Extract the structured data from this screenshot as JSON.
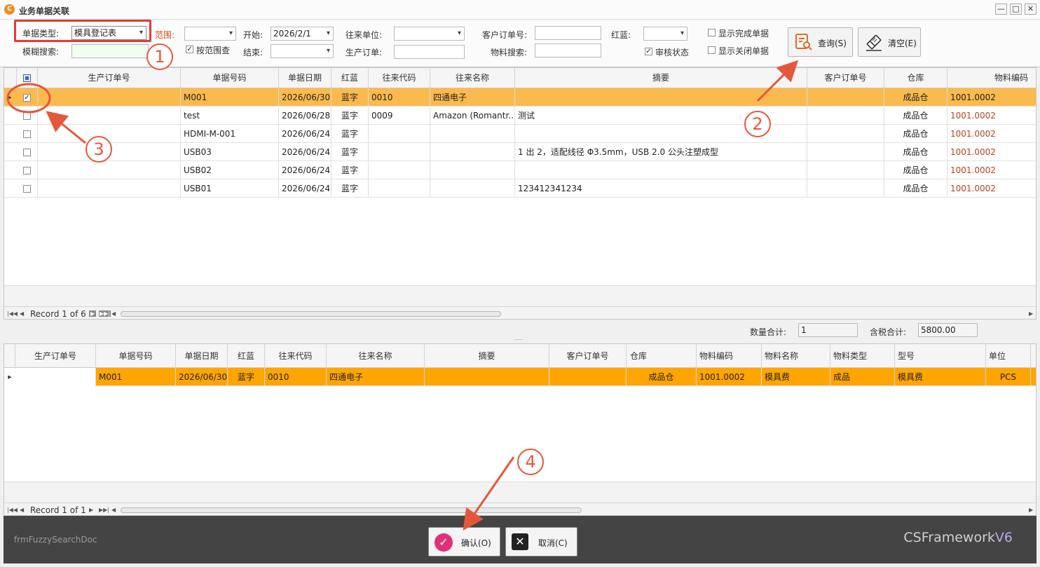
{
  "window": {
    "title": "业务单据关联",
    "min": "—",
    "max": "□",
    "close": "✕"
  },
  "filter": {
    "doc_type_label": "单据类型:",
    "doc_type_value": "模具登记表",
    "fuzzy_label": "模糊搜索:",
    "fuzzy_value": "",
    "range_label": "范围:",
    "range_value": "",
    "range_check_label": "按范围查",
    "range_checked": true,
    "start_label": "开始:",
    "start_value": "2026/2/1",
    "end_label": "结束:",
    "end_value": "",
    "partner_label": "往来单位:",
    "partner_value": "",
    "prod_order_label": "生产订单:",
    "prod_order_value": "",
    "cust_order_label": "客户订单号:",
    "cust_order_value": "",
    "material_label": "物料搜索:",
    "material_value": "",
    "redblue_label": "红蓝:",
    "redblue_value": "",
    "show_done_label": "显示完成单据",
    "show_done": false,
    "audit_label": "审核状态",
    "audit": true,
    "show_closed_label": "显示关闭单据",
    "show_closed": false,
    "query_label": "查询(S)",
    "clear_label": "清空(E)"
  },
  "top_grid": {
    "columns": [
      "",
      "生产订单号",
      "单据号码",
      "单据日期",
      "红蓝",
      "往来代码",
      "往来名称",
      "摘要",
      "客户订单号",
      "仓库",
      "物料编码"
    ],
    "rows": [
      {
        "checked": true,
        "prod_order": "",
        "doc_no": "M001",
        "date": "2026/06/30",
        "rb": "蓝字",
        "code": "0010",
        "name": "四通电子",
        "summary": "",
        "cust": "",
        "wh": "成品仓",
        "mat": "1001.0002"
      },
      {
        "checked": false,
        "prod_order": "",
        "doc_no": "test",
        "date": "2026/06/28",
        "rb": "蓝字",
        "code": "0009",
        "name": "Amazon (Romantr...",
        "summary": "测试",
        "cust": "",
        "wh": "成品仓",
        "mat": "1001.0002"
      },
      {
        "checked": false,
        "prod_order": "",
        "doc_no": "HDMI-M-001",
        "date": "2026/06/24",
        "rb": "蓝字",
        "code": "",
        "name": "",
        "summary": "",
        "cust": "",
        "wh": "成品仓",
        "mat": "1001.0002"
      },
      {
        "checked": false,
        "prod_order": "",
        "doc_no": "USB03",
        "date": "2026/06/24",
        "rb": "蓝字",
        "code": "",
        "name": "",
        "summary": "1 出 2，适配线径 Φ3.5mm，USB 2.0 公头注塑成型",
        "cust": "",
        "wh": "成品仓",
        "mat": "1001.0002"
      },
      {
        "checked": false,
        "prod_order": "",
        "doc_no": "USB02",
        "date": "2026/06/24",
        "rb": "蓝字",
        "code": "",
        "name": "",
        "summary": "",
        "cust": "",
        "wh": "成品仓",
        "mat": "1001.0002"
      },
      {
        "checked": false,
        "prod_order": "",
        "doc_no": "USB01",
        "date": "2026/06/24",
        "rb": "蓝字",
        "code": "",
        "name": "",
        "summary": "123412341234",
        "cust": "",
        "wh": "成品仓",
        "mat": "1001.0002"
      }
    ],
    "record_text": "Record 1 of 6"
  },
  "totals": {
    "qty_label": "数量合计:",
    "qty_value": "1",
    "tax_label": "含税合计:",
    "tax_value": "5800.00",
    "splitter": "....."
  },
  "bottom_grid": {
    "columns": [
      "生产订单号",
      "单据号码",
      "单据日期",
      "红蓝",
      "往来代码",
      "往来名称",
      "摘要",
      "客户订单号",
      "仓库",
      "物料编码",
      "物料名称",
      "物料类型",
      "型号",
      "单位"
    ],
    "rows": [
      {
        "prod_order": "",
        "doc_no": "M001",
        "date": "2026/06/30",
        "rb": "蓝字",
        "code": "0010",
        "name": "四通电子",
        "summary": "",
        "cust": "",
        "wh": "成品仓",
        "mat": "1001.0002",
        "mat_name": "模具费",
        "mat_type": "成品",
        "model": "模具费",
        "unit": "PCS"
      }
    ],
    "record_text": "Record 1 of 1"
  },
  "footer": {
    "form_name": "frmFuzzySearchDoc",
    "brand_main": "CSFramework",
    "brand_ver": "V6",
    "ok_label": "确认(O)",
    "cancel_label": "取消(C)"
  },
  "callouts": [
    "1",
    "2",
    "3",
    "4"
  ],
  "colors": {
    "highlight_row": "#fbba4e",
    "selected_row": "#ffa500",
    "callout": "#e5573b",
    "footer_bg": "#444444"
  }
}
